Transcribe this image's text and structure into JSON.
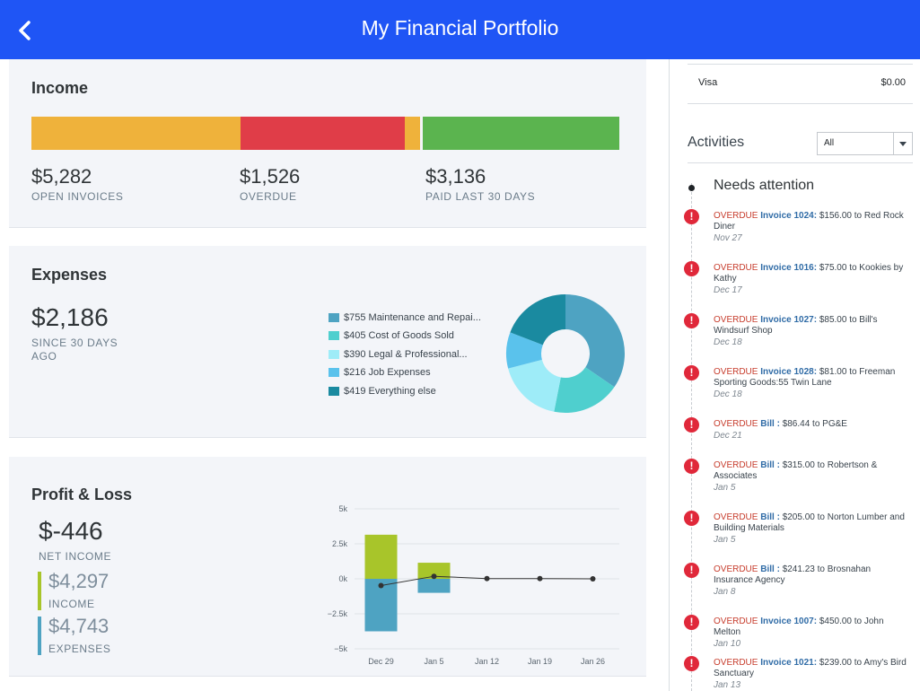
{
  "header": {
    "title": "My Financial Portfolio"
  },
  "income": {
    "title": "Income",
    "bar_segments": [
      {
        "label": "open invoices",
        "color": "#efb23b",
        "share": 0.355
      },
      {
        "label": "overdue",
        "color": "#e03d48",
        "share": 0.28
      },
      {
        "label": "open invoices (current)",
        "color": "#efb23b",
        "share": 0.03
      },
      {
        "label": "paid last 30 days",
        "color": "#5bb44f",
        "share": 0.335
      }
    ],
    "stats": [
      {
        "amount": "$5,282",
        "label": "OPEN INVOICES"
      },
      {
        "amount": "$1,526",
        "label": "OVERDUE"
      },
      {
        "amount": "$3,136",
        "label": "PAID LAST 30 DAYS"
      }
    ]
  },
  "expenses": {
    "title": "Expenses",
    "total": "$2,186",
    "period_line1": "SINCE 30 DAYS",
    "period_line2": "AGO",
    "legend": [
      {
        "label": "$755 Maintenance and Repai...",
        "color": "#4ea3c2",
        "value": 755
      },
      {
        "label": "$405 Cost of Goods Sold",
        "color": "#4fcfce",
        "value": 405
      },
      {
        "label": "$390 Legal & Professional...",
        "color": "#9eecf8",
        "value": 390
      },
      {
        "label": "$216 Job Expenses",
        "color": "#5ac2ec",
        "value": 216
      },
      {
        "label": "$419 Everything else",
        "color": "#1a8aa0",
        "value": 419
      }
    ]
  },
  "profit_loss": {
    "title": "Profit & Loss",
    "net": "$-446",
    "net_label": "NET INCOME",
    "income": "$4,297",
    "income_label": "INCOME",
    "income_color": "#a8c52a",
    "expenses": "$4,743",
    "expenses_label": "EXPENSES",
    "expenses_color": "#4ea3c2"
  },
  "chart_data": {
    "type": "bar",
    "categories": [
      "Dec 29",
      "Jan 5",
      "Jan 12",
      "Jan 19",
      "Jan 26"
    ],
    "y_ticks": [
      "5k",
      "2.5k",
      "0k",
      "−2.5k",
      "−5k"
    ],
    "ylim": [
      -5000,
      5000
    ],
    "series": [
      {
        "values": [
          3150,
          1150,
          0,
          0,
          0
        ],
        "color": "#a8c52a",
        "kind": "bar"
      },
      {
        "values": [
          -3750,
          -1000,
          0,
          0,
          0
        ],
        "color": "#4ea3c2",
        "kind": "bar"
      },
      {
        "values": [
          -480,
          180,
          20,
          20,
          0
        ],
        "color": "#333333",
        "kind": "line"
      }
    ],
    "grid": true
  },
  "right": {
    "visa_label": "Visa",
    "visa_amount": "$0.00",
    "activities_label": "Activities",
    "filter_value": "All",
    "needs_attention": "Needs attention",
    "activities": [
      {
        "status": "OVERDUE",
        "doc": "Invoice 1024:",
        "desc": "$156.00 to Red Rock Diner",
        "date": "Nov 27"
      },
      {
        "status": "OVERDUE",
        "doc": "Invoice 1016:",
        "desc": "$75.00 to Kookies by Kathy",
        "date": "Dec 17"
      },
      {
        "status": "OVERDUE",
        "doc": "Invoice 1027:",
        "desc": "$85.00 to Bill's Windsurf Shop",
        "date": "Dec 18"
      },
      {
        "status": "OVERDUE",
        "doc": "Invoice 1028:",
        "desc": "$81.00 to Freeman Sporting Goods:55 Twin Lane",
        "date": "Dec 18"
      },
      {
        "status": "OVERDUE",
        "doc": "Bill :",
        "desc": "$86.44 to PG&E",
        "date": "Dec 21"
      },
      {
        "status": "OVERDUE",
        "doc": "Bill :",
        "desc": "$315.00 to Robertson & Associates",
        "date": "Jan 5"
      },
      {
        "status": "OVERDUE",
        "doc": "Bill :",
        "desc": "$205.00 to Norton Lumber and Building Materials",
        "date": "Jan 5"
      },
      {
        "status": "OVERDUE",
        "doc": "Bill :",
        "desc": "$241.23 to Brosnahan Insurance Agency",
        "date": "Jan 8"
      },
      {
        "status": "OVERDUE",
        "doc": "Invoice 1007:",
        "desc": "$450.00 to John Melton",
        "date": "Jan 10"
      },
      {
        "status": "OVERDUE",
        "doc": "Invoice 1021:",
        "desc": "$239.00 to Amy's Bird Sanctuary",
        "date": "Jan 13"
      }
    ]
  }
}
